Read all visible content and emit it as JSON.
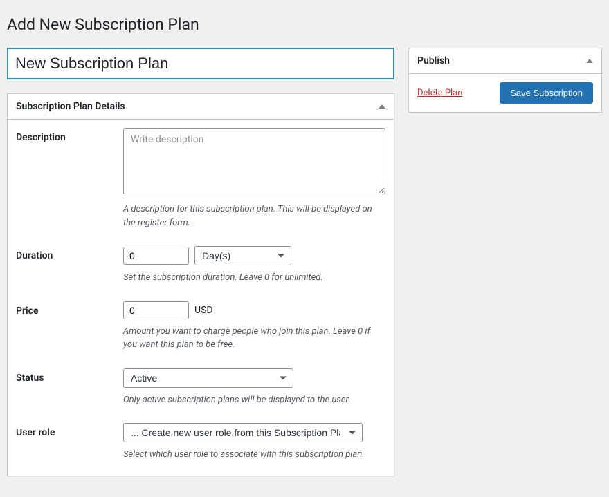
{
  "page": {
    "title": "Add New Subscription Plan"
  },
  "titleField": {
    "value": "New Subscription Plan"
  },
  "detailsBox": {
    "header": "Subscription Plan Details",
    "description": {
      "label": "Description",
      "placeholder": "Write description",
      "value": "",
      "help": "A description for this subscription plan. This will be displayed on the register form."
    },
    "duration": {
      "label": "Duration",
      "value": "0",
      "unitSelected": "Day(s)",
      "help": "Set the subscription duration. Leave 0 for unlimited."
    },
    "price": {
      "label": "Price",
      "value": "0",
      "currency": "USD",
      "help": "Amount you want to charge people who join this plan. Leave 0 if you want this plan to be free."
    },
    "status": {
      "label": "Status",
      "selected": "Active",
      "help": "Only active subscription plans will be displayed to the user."
    },
    "userRole": {
      "label": "User role",
      "selected": "... Create new user role from this Subscription Plan",
      "help": "Select which user role to associate with this subscription plan."
    }
  },
  "publishBox": {
    "header": "Publish",
    "deleteLabel": "Delete Plan",
    "saveLabel": "Save Subscription"
  }
}
